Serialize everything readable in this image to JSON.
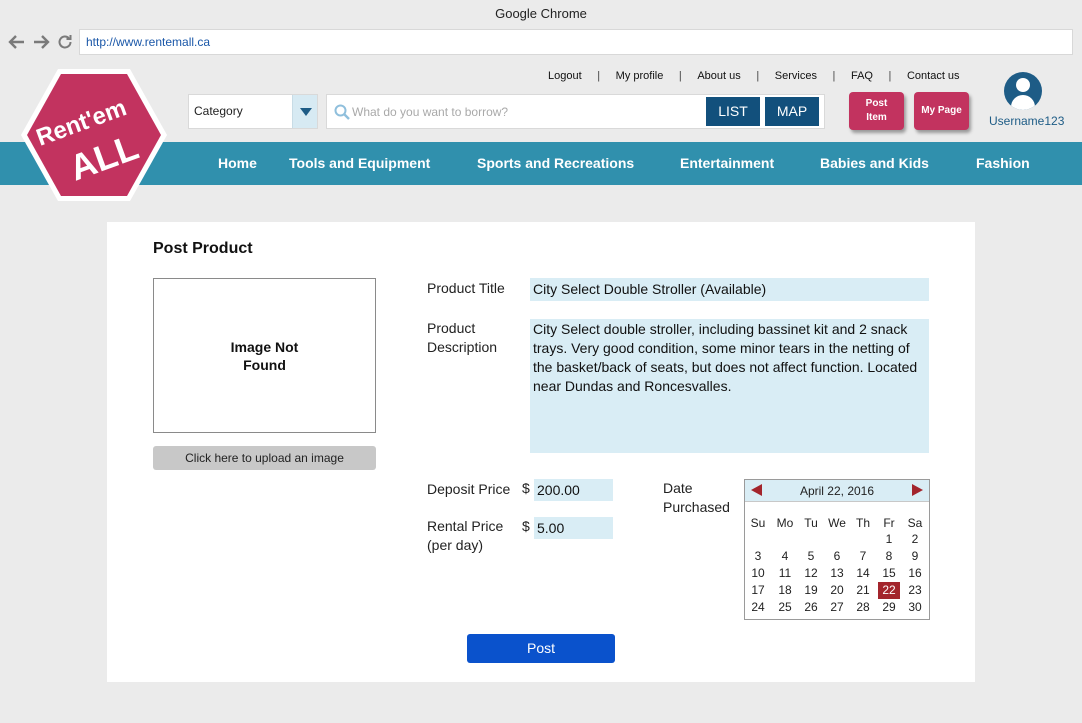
{
  "browser": {
    "title": "Google Chrome",
    "url": "http://www.rentemall.ca"
  },
  "logo": {
    "line1": "Rent'em",
    "line2": "ALL",
    "color": "#c2335f"
  },
  "top_links": [
    "Logout",
    "My profile",
    "About us",
    "Services",
    "FAQ",
    "Contact us"
  ],
  "search": {
    "category_label": "Category",
    "placeholder": "What do you want to borrow?",
    "list_label": "LIST",
    "map_label": "MAP"
  },
  "user_buttons": {
    "post_item": "Post Item",
    "my_page": "My Page",
    "username": "Username123"
  },
  "nav": [
    "Home",
    "Tools and Equipment",
    "Sports and Recreations",
    "Entertainment",
    "Babies and Kids",
    "Fashion"
  ],
  "form": {
    "heading": "Post Product",
    "image_placeholder": "Image Not Found",
    "upload_label": "Click here to upload an image",
    "title_label": "Product Title",
    "title_value": "City Select Double Stroller (Available)",
    "desc_label": "Product Description",
    "desc_value": "City Select double stroller, including bassinet kit and 2 snack trays. Very good condition, some minor tears in the netting of the basket/back of seats, but does not affect function. Located near Dundas and Roncesvalles.",
    "deposit_label": "Deposit Price",
    "deposit_currency": "$",
    "deposit_value": "200.00",
    "rental_label": "Rental Price (per day)",
    "rental_currency": "$",
    "rental_value": "5.00",
    "date_label": "Date Purchased",
    "post_label": "Post"
  },
  "calendar": {
    "month_label": "April 22, 2016",
    "weekdays": [
      "Su",
      "Mo",
      "Tu",
      "We",
      "Th",
      "Fr",
      "Sa"
    ],
    "weeks": [
      [
        "",
        "",
        "",
        "",
        "",
        "1",
        "2"
      ],
      [
        "3",
        "4",
        "5",
        "6",
        "7",
        "8",
        "9"
      ],
      [
        "10",
        "11",
        "12",
        "13",
        "14",
        "15",
        "16"
      ],
      [
        "17",
        "18",
        "19",
        "20",
        "21",
        "22",
        "23"
      ],
      [
        "24",
        "25",
        "26",
        "27",
        "28",
        "29",
        "30"
      ]
    ],
    "selected_day": "22",
    "accent_color": "#a3252c"
  },
  "colors": {
    "nav_bar": "#3090ad",
    "dark_button": "#12507c",
    "field_bg": "#d9edf5",
    "post_button": "#0a52cc"
  }
}
